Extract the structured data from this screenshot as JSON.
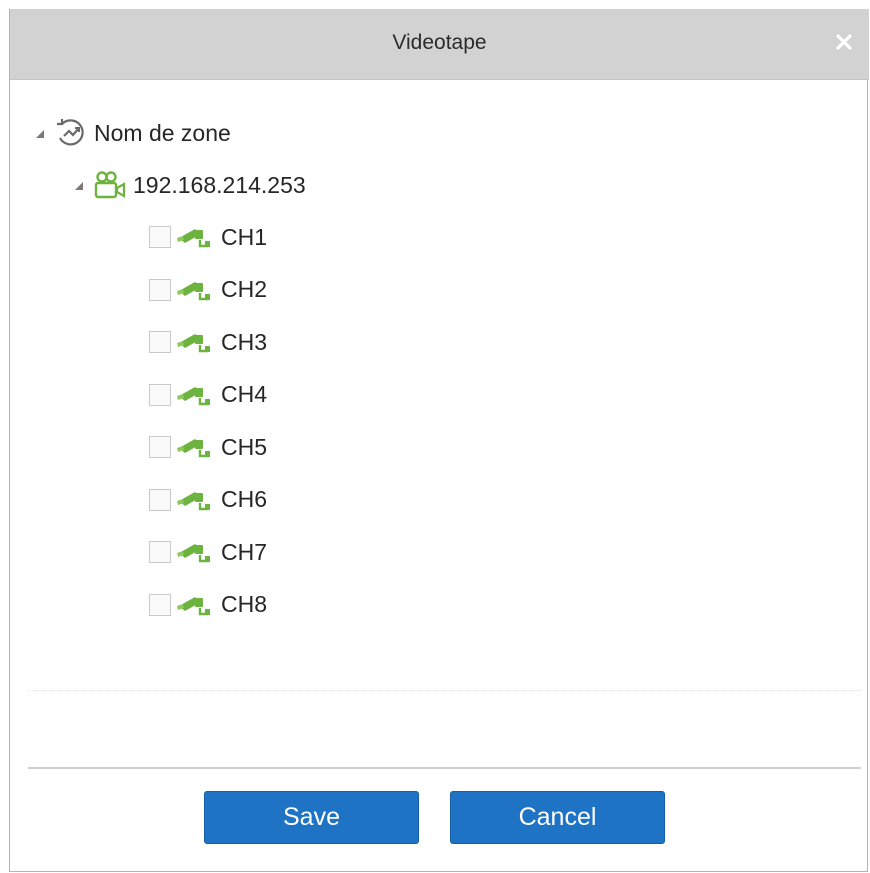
{
  "dialog": {
    "title": "Videotape",
    "close_icon": "close-icon"
  },
  "tree": {
    "zone": {
      "label": "Nom de zone",
      "icon": "zone-icon",
      "expanded": true
    },
    "device": {
      "label": "192.168.214.253",
      "icon": "video-device-icon",
      "expanded": true,
      "color": "#6db33f"
    },
    "channels": [
      {
        "label": "CH1",
        "checked": false,
        "icon": "camera-icon"
      },
      {
        "label": "CH2",
        "checked": false,
        "icon": "camera-icon"
      },
      {
        "label": "CH3",
        "checked": false,
        "icon": "camera-icon"
      },
      {
        "label": "CH4",
        "checked": false,
        "icon": "camera-icon"
      },
      {
        "label": "CH5",
        "checked": false,
        "icon": "camera-icon"
      },
      {
        "label": "CH6",
        "checked": false,
        "icon": "camera-icon"
      },
      {
        "label": "CH7",
        "checked": false,
        "icon": "camera-icon"
      },
      {
        "label": "CH8",
        "checked": false,
        "icon": "camera-icon"
      }
    ]
  },
  "buttons": {
    "save_label": "Save",
    "cancel_label": "Cancel",
    "color": "#1e73c4"
  }
}
